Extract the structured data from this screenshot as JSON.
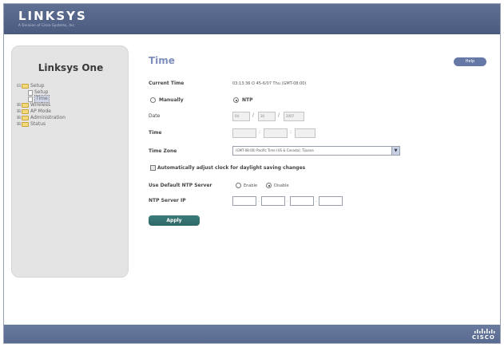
{
  "header": {
    "logo": "LINKSYS",
    "logo_sub": "A Division of Cisco Systems, Inc."
  },
  "sidebar": {
    "title": "Linksys One",
    "items": [
      {
        "label": "Setup",
        "level": 0,
        "expander": "⊟",
        "icon": "folder-icon"
      },
      {
        "label": "Setup",
        "level": 1,
        "icon": "page-icon"
      },
      {
        "label": "Time",
        "level": 1,
        "icon": "page-icon",
        "selected": true
      },
      {
        "label": "Wireless",
        "level": 0,
        "expander": "⊞",
        "icon": "folder-icon"
      },
      {
        "label": "AP Mode",
        "level": 0,
        "expander": "⊞",
        "icon": "folder-icon"
      },
      {
        "label": "Administration",
        "level": 0,
        "expander": "⊞",
        "icon": "folder-icon"
      },
      {
        "label": "Status",
        "level": 0,
        "expander": "⊞",
        "icon": "folder-icon"
      }
    ]
  },
  "page": {
    "title": "Time",
    "help_label": "Help",
    "current_time_label": "Current Time",
    "current_time_value": "03:13:36 O 45-6/07 Thu (GMT-08:00)",
    "manually_label": "Manually",
    "ntp_label": "NTP",
    "date_label": "Date",
    "date_fields": [
      "04",
      "30",
      "2007"
    ],
    "time_label": "Time",
    "time_fields": [
      "",
      "",
      ""
    ],
    "time_zone_label": "Time Zone",
    "time_zone_value": "(GMT-08:00) Pacific Time (US & Canada); Tijuana",
    "dst_label": "Automatically adjust clock for daylight saving changes",
    "default_ntp_label": "Use Default NTP Server",
    "enable_label": "Enable",
    "disable_label": "Disable",
    "ntp_ip_label": "NTP Server IP",
    "ntp_ip_fields": [
      "",
      "",
      "",
      ""
    ],
    "apply_label": "Apply"
  },
  "footer": {
    "brand": "CISCO"
  },
  "colors": {
    "header": "#5a6a8e",
    "title": "#7f8fbd",
    "apply": "#346f6e",
    "help": "#6678a5"
  }
}
